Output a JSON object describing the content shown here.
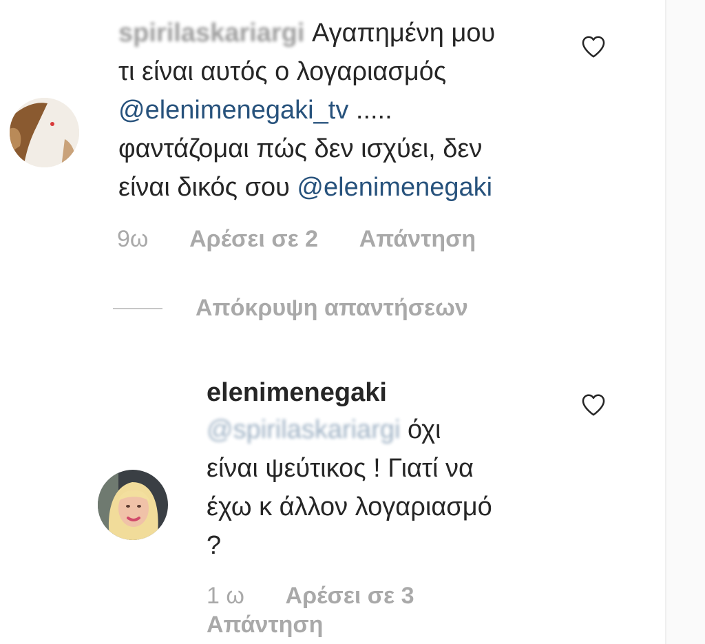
{
  "comment1": {
    "username": "spirilaskariargi",
    "lines": [
      {
        "pre": "",
        "mention": "",
        "post": "Αγαπημένη μου"
      },
      {
        "pre": "τι είναι αυτός ο λογαριασμός",
        "mention": "",
        "post": ""
      },
      {
        "pre": "",
        "mention": "@elenimenegaki_tv",
        "post": " ....."
      },
      {
        "pre": "φαντάζομαι πώς δεν ισχύει, δεν",
        "mention": "",
        "post": ""
      },
      {
        "pre": "είναι δικός σου ",
        "mention": "@elenimenegaki",
        "post": ""
      }
    ],
    "time": "9ω",
    "likes": "Αρέσει σε 2",
    "reply": "Απάντηση"
  },
  "hide_replies": "Απόκρυψη απαντήσεων",
  "comment2": {
    "username": "elenimenegaki",
    "reply_to_mention": "@spirilaskariargi",
    "line1_post": "όχι",
    "line2": "είναι ψεύτικος ! Γιατί να",
    "line3": "έχω κ άλλον λογαριασμό",
    "line4": "?",
    "time": "1 ω",
    "likes": "Αρέσει σε 3",
    "reply": "Απάντηση"
  },
  "icons": {
    "like": "heart-icon",
    "avatar1": "user-avatar",
    "avatar2": "user-avatar"
  },
  "colors": {
    "text": "#262626",
    "mention": "#27527c",
    "meta": "#a9a9a9"
  }
}
